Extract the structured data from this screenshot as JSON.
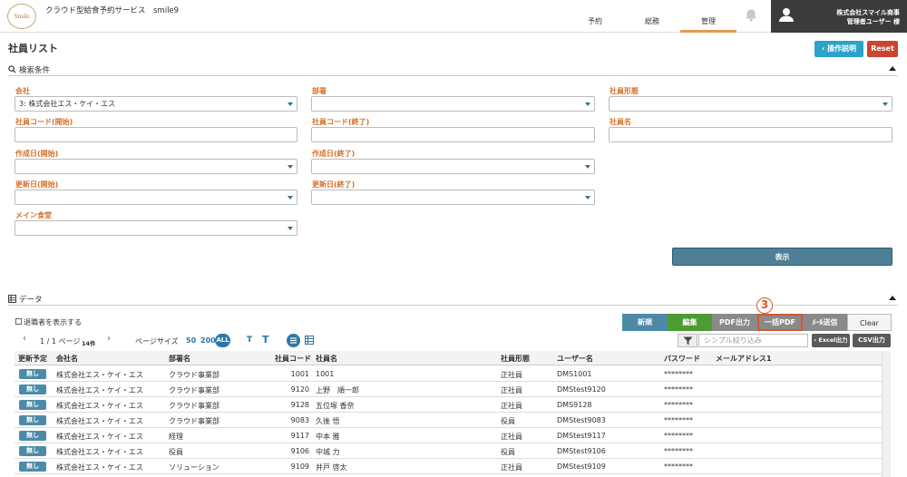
{
  "header": {
    "logo_text": "Smile",
    "app_name": "クラウド型給食予約サービス　smile9",
    "nav": [
      {
        "label": "予約"
      },
      {
        "label": "総務"
      },
      {
        "label": "管理"
      }
    ],
    "user_company": "株式会社スマイル商事",
    "user_name": "管理者ユーザー 様"
  },
  "page": {
    "title": "社員リスト",
    "help_label": "‹ 操作説明",
    "reset_label": "Reset"
  },
  "search": {
    "title": "検索条件",
    "fields": {
      "company_label": "会社",
      "company_value": "3: 株式会社エス・ケイ・エス",
      "dept_label": "部署",
      "emptype_label": "社員形態",
      "code_from_label": "社員コード(開始)",
      "code_to_label": "社員コード(終了)",
      "name_label": "社員名",
      "created_from_label": "作成日(開始)",
      "created_to_label": "作成日(終了)",
      "updated_from_label": "更新日(開始)",
      "updated_to_label": "更新日(終了)",
      "cafeteria_label": "メイン食堂"
    },
    "show_label": "表示"
  },
  "data_section": {
    "title": "データ",
    "show_retired_label": "退職者を表示する",
    "pager_text": "1 / 1 ページ",
    "count_text": "14件",
    "page_size_label": "ページサイズ",
    "page_size_options": [
      "50",
      "200",
      "ALL"
    ],
    "font_small": "T",
    "font_large": "T",
    "filter_placeholder": "シンプル絞り込み",
    "excel_label": "‹ Excel出力",
    "csv_label": "CSV出力",
    "step_number": "3",
    "buttons": {
      "new": "新規",
      "edit": "編集",
      "pdf": "PDF出力",
      "bulk_pdf": "一括PDF",
      "mail": "ﾒｰﾙ送信",
      "clear": "Clear"
    }
  },
  "table": {
    "columns": [
      "更新予定",
      "会社名",
      "部署名",
      "社員コード",
      "社員名",
      "社員形態",
      "ユーザー名",
      "パスワード",
      "メールアドレス1"
    ],
    "rows": [
      {
        "flag": "無し",
        "company": "株式会社エス・ケイ・エス",
        "dept": "クラウド事業部",
        "code": "1001",
        "name": "1001",
        "type": "正社員",
        "user": "DMS1001",
        "pass": "********",
        "mail": ""
      },
      {
        "flag": "無し",
        "company": "株式会社エス・ケイ・エス",
        "dept": "クラウド事業部",
        "code": "9120",
        "name": "上野　順一郎",
        "type": "正社員",
        "user": "DMStest9120",
        "pass": "********",
        "mail": ""
      },
      {
        "flag": "無し",
        "company": "株式会社エス・ケイ・エス",
        "dept": "クラウド事業部",
        "code": "9128",
        "name": "五位塚 香奈",
        "type": "正社員",
        "user": "DMS9128",
        "pass": "********",
        "mail": ""
      },
      {
        "flag": "無し",
        "company": "株式会社エス・ケイ・エス",
        "dept": "クラウド事業部",
        "code": "9083",
        "name": "久後 悟",
        "type": "役員",
        "user": "DMStest9083",
        "pass": "********",
        "mail": ""
      },
      {
        "flag": "無し",
        "company": "株式会社エス・ケイ・エス",
        "dept": "経理",
        "code": "9117",
        "name": "中本 雅",
        "type": "正社員",
        "user": "DMStest9117",
        "pass": "********",
        "mail": ""
      },
      {
        "flag": "無し",
        "company": "株式会社エス・ケイ・エス",
        "dept": "役員",
        "code": "9106",
        "name": "中城 力",
        "type": "役員",
        "user": "DMStest9106",
        "pass": "********",
        "mail": ""
      },
      {
        "flag": "無し",
        "company": "株式会社エス・ケイ・エス",
        "dept": "ソリューション",
        "code": "9109",
        "name": "井戸 啓太",
        "type": "正社員",
        "user": "DMStest9109",
        "pass": "********",
        "mail": ""
      }
    ]
  }
}
